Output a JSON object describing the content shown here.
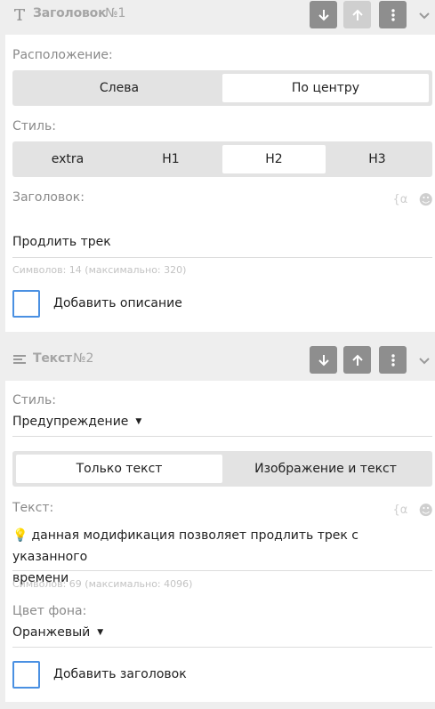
{
  "block1": {
    "title": "Заголовок",
    "number": "№1",
    "icon": "text-T-icon",
    "position_label": "Расположение:",
    "position_options": [
      "Слева",
      "По центру"
    ],
    "position_selected": "По центру",
    "style_label": "Стиль:",
    "style_options": [
      "extra",
      "H1",
      "H2",
      "H3"
    ],
    "style_selected": "H2",
    "heading_label": "Заголовок:",
    "heading_value": "Продлить трек",
    "heading_counter": "Символов: 14 (максимально: 320)",
    "add_description_label": "Добавить описание"
  },
  "block2": {
    "title": "Текст",
    "number": "№2",
    "icon": "paragraph-lines-icon",
    "style_label": "Стиль:",
    "style_value": "Предупреждение",
    "mode_options": [
      "Только текст",
      "Изображение и текст"
    ],
    "mode_selected": "Только текст",
    "text_label": "Текст:",
    "text_line1": "данная модификация позволяет продлить трек с указанного",
    "text_line2": "времени",
    "text_emoji": "💡",
    "text_counter": "Символов: 69 (максимально: 4096)",
    "bg_label": "Цвет фона:",
    "bg_value": "Оранжевый",
    "add_heading_label": "Добавить заголовок"
  },
  "field_icons": {
    "variable": "{α",
    "emoji": "☻"
  },
  "colors": {
    "button": "#8e8e8e",
    "button_disabled": "#cfcfcf",
    "checkbox_border": "#4a90e2"
  }
}
